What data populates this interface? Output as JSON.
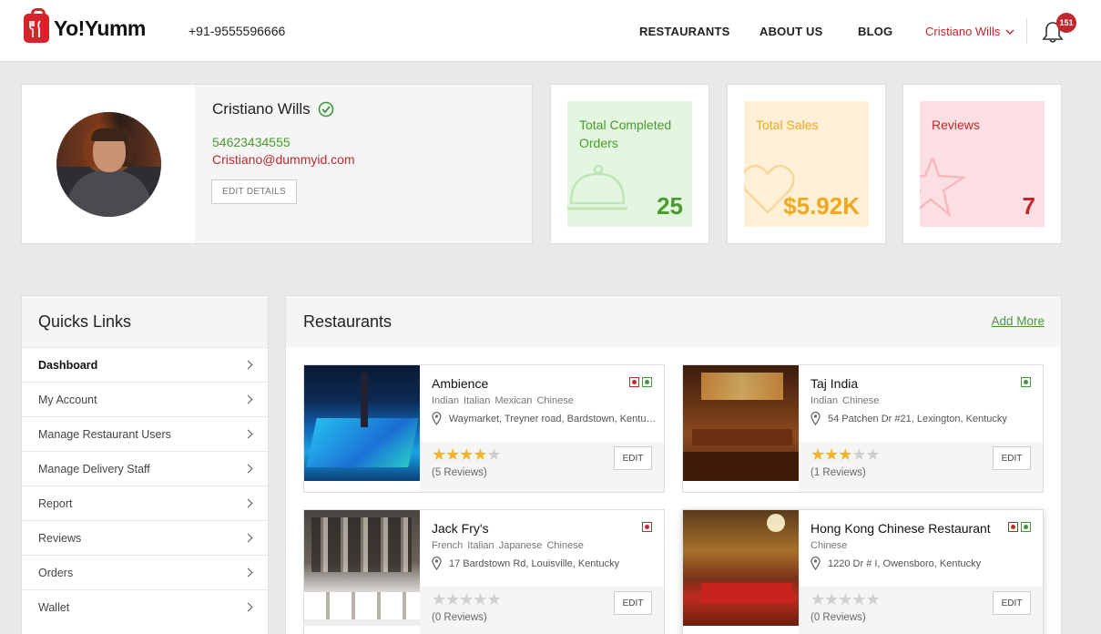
{
  "brand": {
    "name": "Yo!Yumm",
    "phone": "+91-9555596666",
    "accent": "#c2272d",
    "green": "#4a9a2f"
  },
  "nav": {
    "restaurants": "RESTAURANTS",
    "about": "ABOUT US",
    "blog": "BLOG",
    "user": "Cristiano Wills",
    "notifications": "151"
  },
  "profile": {
    "name": "Cristiano Wills",
    "phone": "54623434555",
    "email": "Cristiano@dummyid.com",
    "edit_label": "EDIT DETAILS"
  },
  "stats": [
    {
      "label": "Total Completed Orders",
      "value": "25",
      "bg": "#e3f6df",
      "fg": "#4a9a2f",
      "icon": "cloche-icon"
    },
    {
      "label": "Total Sales",
      "value": "$5.92K",
      "bg": "#fdf0d6",
      "fg": "#f0a81c",
      "icon": "heart-icon"
    },
    {
      "label": "Reviews",
      "value": "7",
      "bg": "#fbdfe2",
      "fg": "#c2272d",
      "icon": "star-icon"
    }
  ],
  "quick_links": {
    "title": "Quicks Links",
    "items": [
      "Dashboard",
      "My Account",
      "Manage Restaurant Users",
      "Manage Delivery Staff",
      "Report",
      "Reviews",
      "Orders",
      "Wallet"
    ]
  },
  "restaurants_panel": {
    "title": "Restaurants",
    "add_more": "Add More",
    "edit_label": "EDIT"
  },
  "restaurants": [
    {
      "name": "Ambience",
      "cuisine": "Indian Italian Mexican Chinese",
      "address": "Waymarket, Treyner road, Bardstown, Kentucky",
      "rating": 4,
      "reviews": "(5 Reviews)",
      "veg": true,
      "nonveg": true
    },
    {
      "name": "Taj India",
      "cuisine": "Indian Chinese",
      "address": "54 Patchen Dr #21, Lexington, Kentucky",
      "rating": 3,
      "reviews": "(1 Reviews)",
      "veg": true,
      "nonveg": false
    },
    {
      "name": "Jack Fry's",
      "cuisine": "French Italian Japanese Chinese",
      "address": "17 Bardstown Rd, Louisville, Kentucky",
      "rating": 0,
      "reviews": "(0 Reviews)",
      "veg": false,
      "nonveg": true
    },
    {
      "name": "Hong Kong Chinese Restaurant",
      "cuisine": "Chinese",
      "address": "1220 Dr # I, Owensboro, Kentucky",
      "rating": 0,
      "reviews": "(0 Reviews)",
      "veg": true,
      "nonveg": true
    }
  ]
}
